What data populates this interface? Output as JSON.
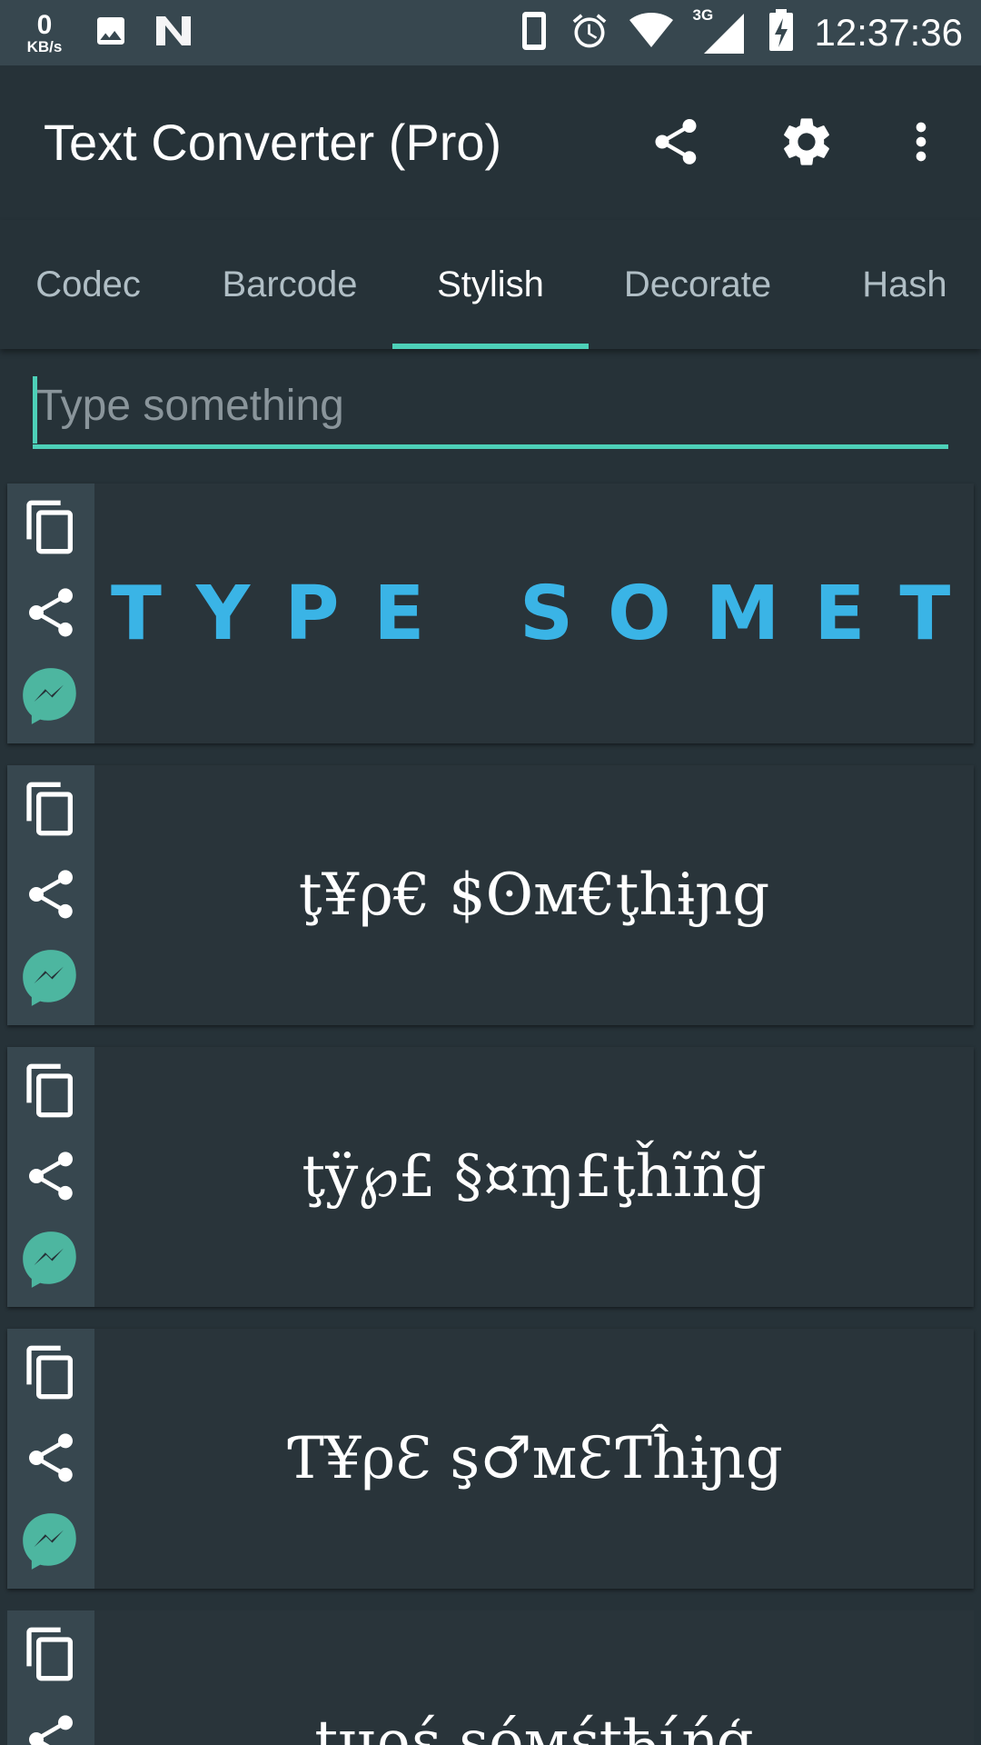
{
  "status_bar": {
    "data_speed_value": "0",
    "data_speed_unit": "KB/s",
    "network_type": "3G",
    "time": "12:37:36"
  },
  "app_bar": {
    "title": "Text Converter (Pro)",
    "icons": [
      "share-icon",
      "settings-icon",
      "overflow-menu-icon"
    ]
  },
  "tabs": [
    {
      "label": "Codec",
      "active": false
    },
    {
      "label": "Barcode",
      "active": false
    },
    {
      "label": "Stylish",
      "active": true
    },
    {
      "label": "Decorate",
      "active": false
    },
    {
      "label": "Hash",
      "active": false
    }
  ],
  "input": {
    "placeholder": "Type something",
    "value": ""
  },
  "results": [
    {
      "text": "TYPE SOMETH"
    },
    {
      "text": "ţ¥ρ€ $ʘм€ţhɨɲg"
    },
    {
      "text": "ţÿ℘£ §¤ɱ£ţȟĩñğ"
    },
    {
      "text": "Ƭ¥ρƐ ş♂мƐƬĥɨɲg"
    },
    {
      "text": "tџρέ şóмέtђίήģ"
    }
  ],
  "colors": {
    "accent": "#4dd0b8",
    "stylish_text": "#3ab4e6",
    "messenger": "#4db6a0",
    "background": "#263238",
    "status_bar": "#37474f"
  }
}
